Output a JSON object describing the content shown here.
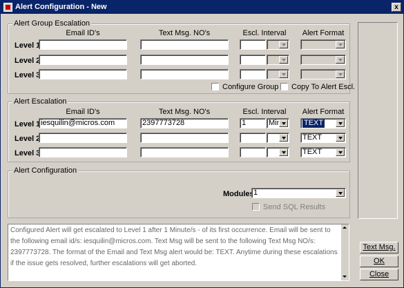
{
  "window": {
    "title": "Alert Configuration - New",
    "close_label": "x"
  },
  "columns": {
    "email": "Email ID's",
    "text": "Text Msg. NO's",
    "interval": "Escl. Interval",
    "format": "Alert Format"
  },
  "levels": [
    "Level 1",
    "Level 2",
    "Level 3"
  ],
  "group_escalation": {
    "label": "Alert Group Escalation",
    "rows": [
      {
        "email": "",
        "text": "",
        "interval": "",
        "unit": "",
        "format": ""
      },
      {
        "email": "",
        "text": "",
        "interval": "",
        "unit": "",
        "format": ""
      },
      {
        "email": "",
        "text": "",
        "interval": "",
        "unit": "",
        "format": ""
      }
    ],
    "configure_group": "Configure Group",
    "copy_to_escl": "Copy To Alert Escl."
  },
  "escalation": {
    "label": "Alert Escalation",
    "rows": [
      {
        "email": "iesquilin@micros.com",
        "text": "2397773728",
        "interval": "1",
        "unit": "Min",
        "format": "TEXT"
      },
      {
        "email": "",
        "text": "",
        "interval": "",
        "unit": "",
        "format": "TEXT"
      },
      {
        "email": "",
        "text": "",
        "interval": "",
        "unit": "",
        "format": "TEXT"
      }
    ]
  },
  "configuration": {
    "label": "Alert Configuration",
    "modules_label": "Modules",
    "modules_value": "1",
    "send_sql": "Send SQL Results"
  },
  "description": "Configured Alert will get escalated to Level 1 after 1 Minute/s - of its first occurrence. Email will be sent to the following email id/s: iesquilin@micros.com. Text Msg will be sent to the following Text Msg NO/s: 2397773728. The format of the Email and Text Msg alert would be: TEXT. Anytime during these escalations if the issue gets resolved, further escalations will get aborted.",
  "buttons": {
    "text_msg": "Text Msg.",
    "ok": "OK",
    "close": "Close"
  },
  "colors": {
    "titlebar": "#0a246a",
    "window_bg": "#d4d0c8"
  }
}
